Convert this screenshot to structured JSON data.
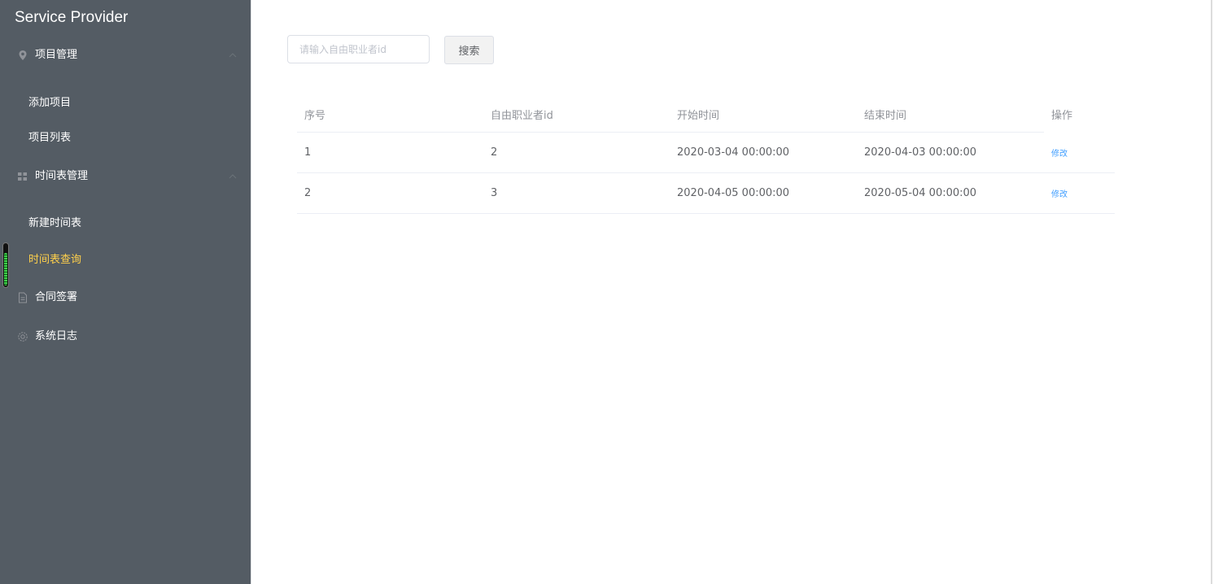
{
  "app": {
    "title": "Service Provider"
  },
  "sidebar": {
    "groups": [
      {
        "label": "项目管理",
        "icon": "location-icon",
        "items": [
          "添加项目",
          "项目列表"
        ]
      },
      {
        "label": "时间表管理",
        "icon": "grid-icon",
        "items": [
          "新建时间表",
          "时间表查询"
        ]
      },
      {
        "label": "合同签署",
        "icon": "document-icon",
        "items": []
      },
      {
        "label": "系统日志",
        "icon": "gear-icon",
        "items": []
      }
    ],
    "active_item": "时间表查询"
  },
  "search": {
    "placeholder": "请输入自由职业者id",
    "button_label": "搜索"
  },
  "table": {
    "columns": [
      "序号",
      "自由职业者id",
      "开始时间",
      "结束时间",
      "操作"
    ],
    "rows": [
      {
        "index": "1",
        "freelancer_id": "2",
        "start": "2020-03-04 00:00:00",
        "end": "2020-04-03 00:00:00",
        "action": "修改"
      },
      {
        "index": "2",
        "freelancer_id": "3",
        "start": "2020-04-05 00:00:00",
        "end": "2020-05-04 00:00:00",
        "action": "修改"
      }
    ]
  },
  "colors": {
    "sidebar_bg": "#545c64",
    "active_text": "#ffd04b",
    "link": "#409eff"
  }
}
